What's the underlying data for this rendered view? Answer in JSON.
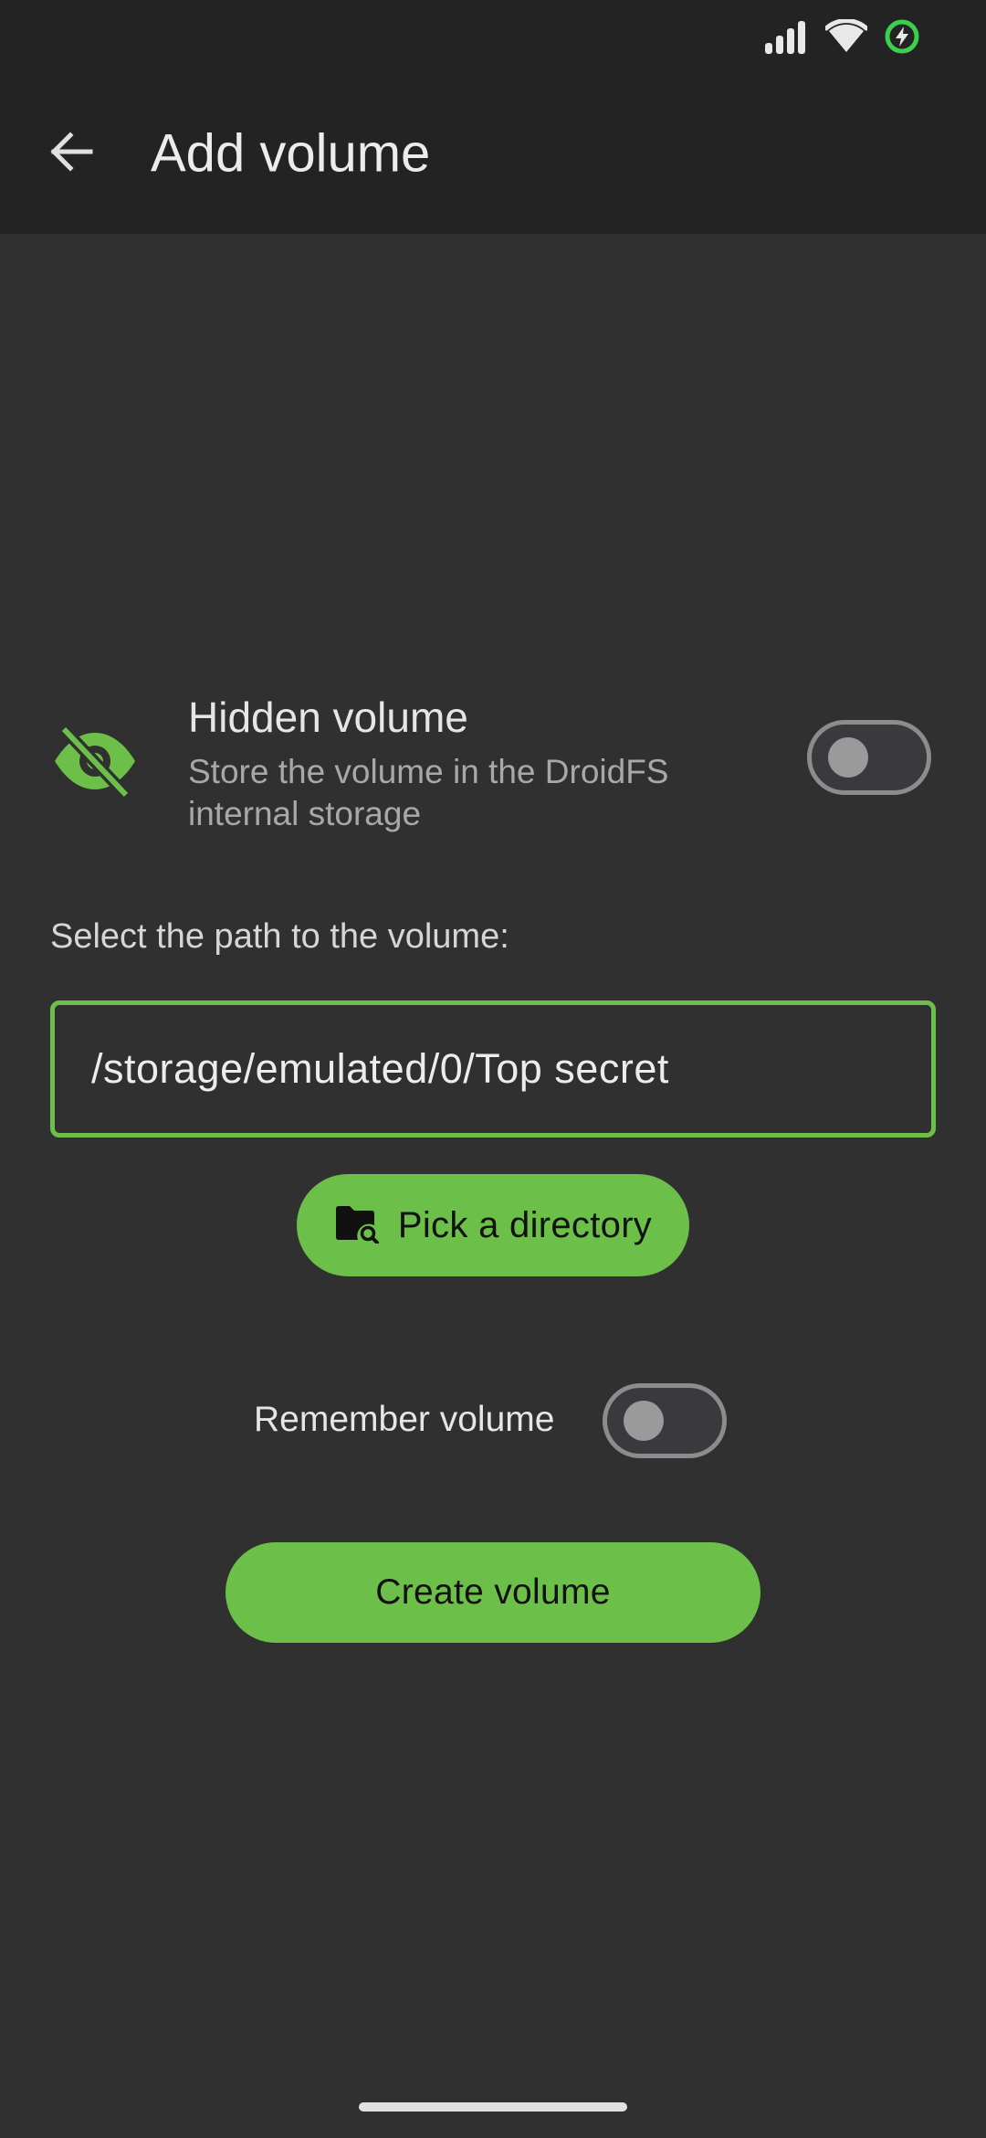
{
  "status_bar": {
    "icons": [
      "signal-icon",
      "wifi-icon",
      "battery-charging-icon"
    ],
    "battery_accent": "#3ccf4e"
  },
  "app_bar": {
    "back_icon": "arrow-back-icon",
    "title": "Add volume"
  },
  "hidden_volume": {
    "icon": "eye-off-icon",
    "title": "Hidden volume",
    "description": "Store the volume in the DroidFS internal storage",
    "enabled": false
  },
  "path": {
    "label": "Select the path to the volume:",
    "value": "/storage/emulated/0/Top secret"
  },
  "pick_directory": {
    "icon": "folder-search-icon",
    "label": "Pick a directory"
  },
  "remember_volume": {
    "label": "Remember volume",
    "enabled": false
  },
  "create_button": {
    "label": "Create volume"
  },
  "colors": {
    "accent": "#6cc04a",
    "background": "#303030",
    "app_bar": "#232323"
  }
}
